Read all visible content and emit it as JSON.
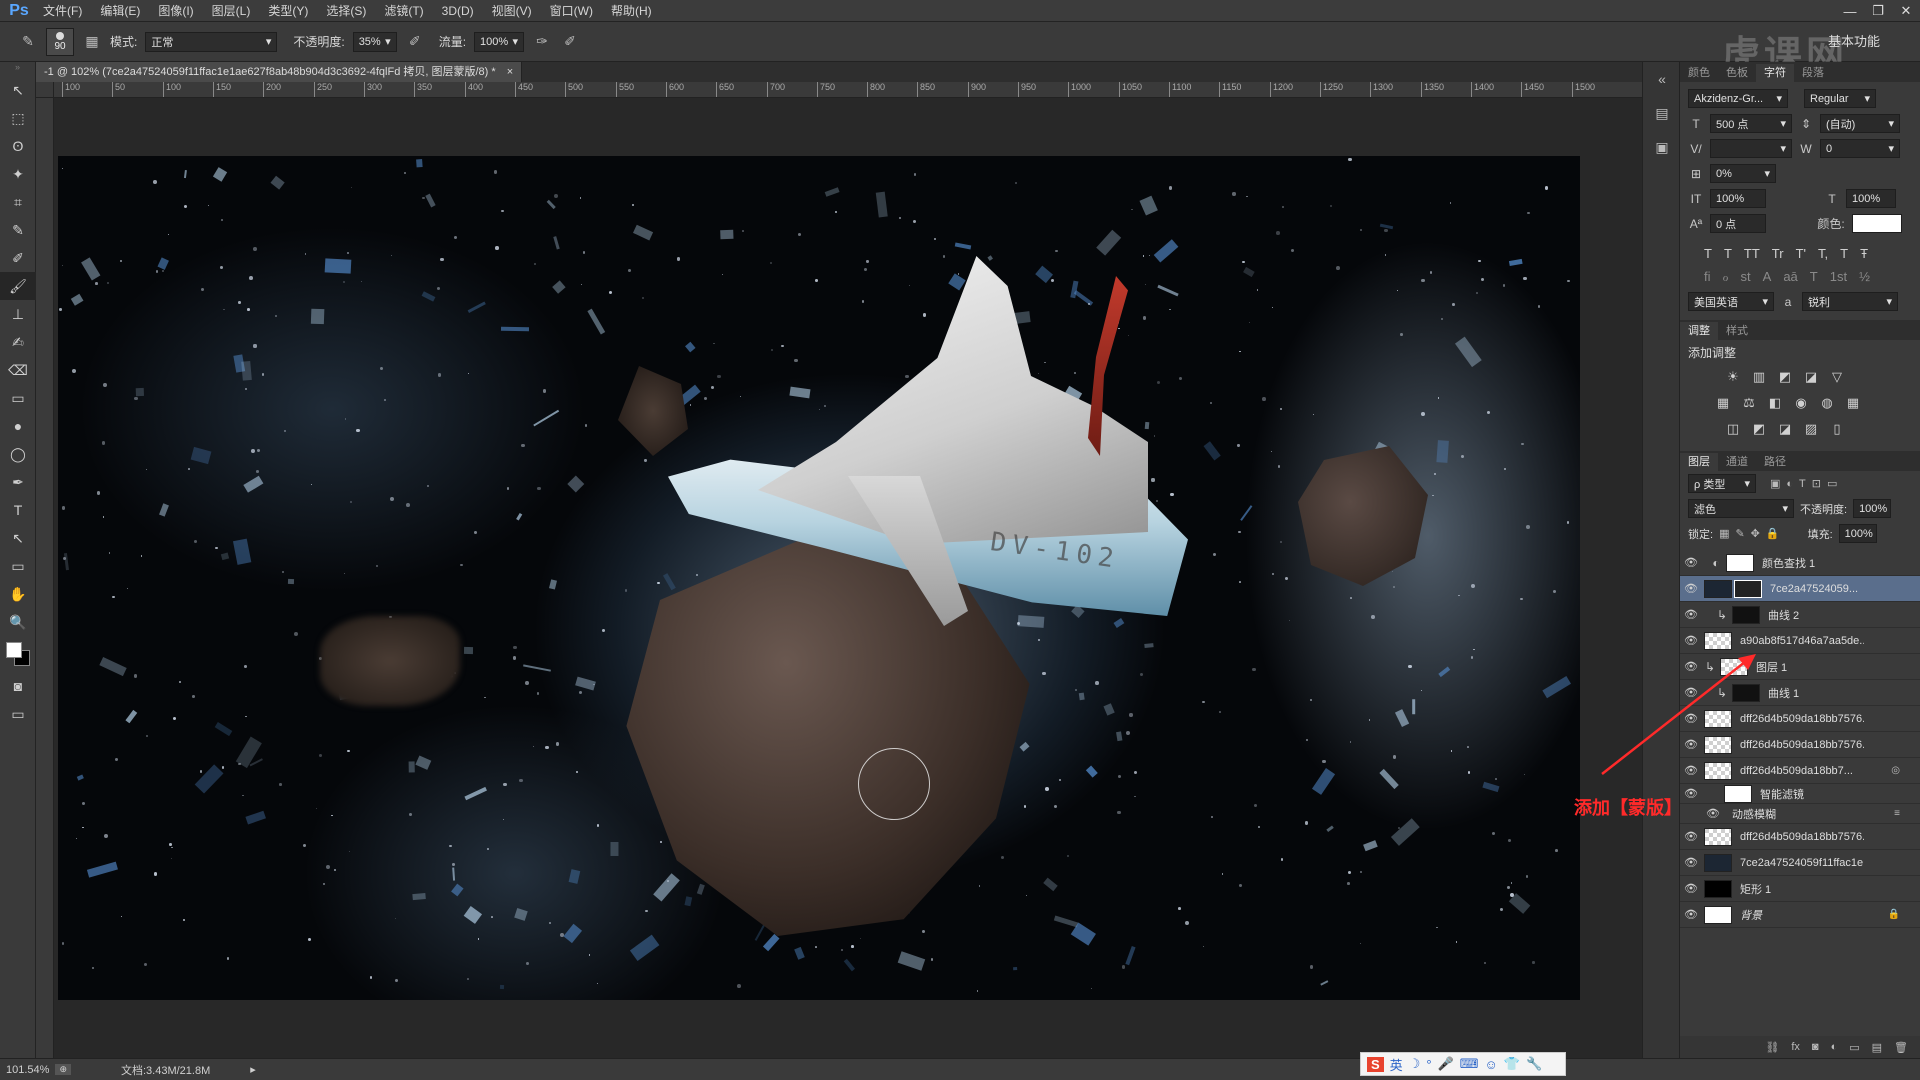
{
  "menu": {
    "logo": "Ps",
    "items": [
      "文件(F)",
      "编辑(E)",
      "图像(I)",
      "图层(L)",
      "类型(Y)",
      "选择(S)",
      "滤镜(T)",
      "3D(D)",
      "视图(V)",
      "窗口(W)",
      "帮助(H)"
    ]
  },
  "window_controls": [
    "—",
    "❐",
    "✕"
  ],
  "options": {
    "brush_size": "90",
    "mode_label": "模式:",
    "mode_value": "正常",
    "opacity_label": "不透明度:",
    "opacity_value": "35%",
    "flow_label": "流量:",
    "flow_value": "100%",
    "workspace": "基本功能"
  },
  "watermark": "虎课网",
  "document": {
    "tab_title": "-1 @ 102% (7ce2a47524059f11ffac1e1ae627f8ab48b904d3c3692-4fqlFd 拷贝, 图层蒙版/8) *",
    "close": "×",
    "ruler_ticks": [
      "100",
      "50",
      "100",
      "150",
      "200",
      "250",
      "300",
      "350",
      "400",
      "450",
      "500",
      "550",
      "600",
      "650",
      "700",
      "750",
      "800",
      "850",
      "900",
      "950",
      "1000",
      "1050",
      "1100",
      "1150",
      "1200",
      "1250",
      "1300",
      "1350",
      "1400",
      "1450",
      "1500"
    ],
    "shoe_print": "DV-102"
  },
  "tools": [
    "↖",
    "⬚",
    "ʘ",
    "✦",
    "⌗",
    "✎",
    "✐",
    "🖌",
    "⊥",
    "✍",
    "⌫",
    "▭",
    "●",
    "◯",
    "✒",
    "T",
    "↖",
    "▭",
    "✋",
    "🔍"
  ],
  "character_panel": {
    "tabs": [
      "颜色",
      "色板",
      "字符",
      "段落"
    ],
    "active_tab": "字符",
    "font_family": "Akzidenz-Gr...",
    "font_style": "Regular",
    "font_size": "500 点",
    "leading": "(自动)",
    "kerning": "",
    "tracking": "0",
    "scale_label_pct": "0%",
    "vertical_scale": "100%",
    "horizontal_scale": "100%",
    "baseline": "0 点",
    "color_label": "颜色:",
    "glyph_row1": [
      "T",
      "T",
      "TT",
      "Tr",
      "T'",
      "T,",
      "T",
      "Ŧ"
    ],
    "glyph_row2": [
      "fi",
      "ℴ",
      "st",
      "A",
      "aā",
      "T",
      "1st",
      "½"
    ],
    "language": "美国英语",
    "aa_label": "a",
    "antialias": "锐利"
  },
  "adjust_panel": {
    "tabs": [
      "调整",
      "样式"
    ],
    "title": "添加调整",
    "row1": [
      "☀",
      "▥",
      "◩",
      "◪",
      "▽"
    ],
    "row2": [
      "▦",
      "⚖",
      "◧",
      "◉",
      "◍",
      "▦"
    ],
    "row3": [
      "◫",
      "◩",
      "◪",
      "▨",
      "▯"
    ]
  },
  "layers_panel": {
    "tabs": [
      "图层",
      "通道",
      "路径"
    ],
    "filter_kind": "ρ 类型",
    "blend_mode": "滤色",
    "opacity_label": "不透明度:",
    "opacity_value": "100%",
    "lock_label": "锁定:",
    "fill_label": "填充:",
    "fill_value": "100%",
    "layers": [
      {
        "name": "颜色查找 1",
        "selected": false
      },
      {
        "name": "7ce2a47524059...",
        "selected": true
      },
      {
        "name": "曲线 2",
        "selected": false
      },
      {
        "name": "a90ab8f517d46a7aa5de...",
        "selected": false
      },
      {
        "name": "图层 1",
        "selected": false
      },
      {
        "name": "曲线 1",
        "selected": false
      },
      {
        "name": "dff26d4b509da18bb7576...",
        "selected": false
      },
      {
        "name": "dff26d4b509da18bb7576...",
        "selected": false
      },
      {
        "name": "dff26d4b509da18bb7...",
        "selected": false
      },
      {
        "name": "智能滤镜",
        "selected": false
      },
      {
        "name": "动感模糊",
        "selected": false
      },
      {
        "name": "dff26d4b509da18bb7576...",
        "selected": false
      },
      {
        "name": "7ce2a47524059f11ffac1e...",
        "selected": false
      },
      {
        "name": "矩形 1",
        "selected": false
      },
      {
        "name": "背景",
        "selected": false
      }
    ]
  },
  "status": {
    "zoom": "101.54%",
    "doc_size": "文档:3.43M/21.8M"
  },
  "ime": {
    "logo": "S",
    "lang": "英",
    "icons": [
      "☽",
      "°",
      "🎤",
      "⌨",
      "☺",
      "👕",
      "🔧"
    ]
  },
  "annotation": {
    "text": "添加【蒙版】",
    "color": "#ff2a2a"
  }
}
